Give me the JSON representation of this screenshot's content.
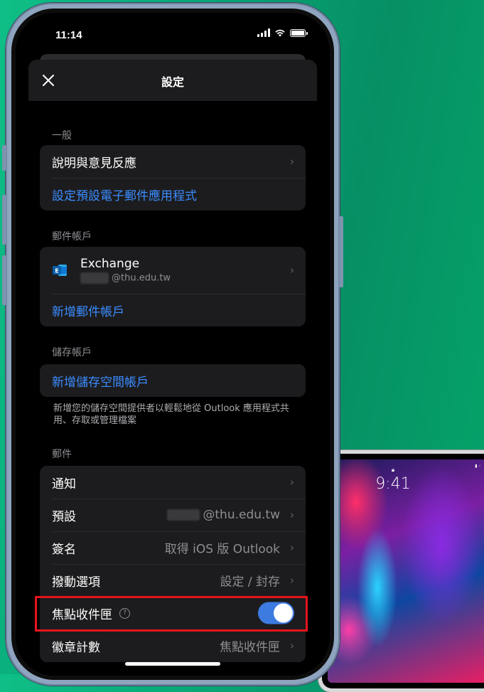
{
  "status": {
    "time": "11:14"
  },
  "header": {
    "title": "設定"
  },
  "general": {
    "label": "一般",
    "help": "說明與意見反應",
    "default_app": "設定預設電子郵件應用程式"
  },
  "mail_accounts": {
    "label": "郵件帳戶",
    "account_name": "Exchange",
    "account_email": "@thu.edu.tw",
    "add": "新增郵件帳戶"
  },
  "storage": {
    "label": "儲存帳戶",
    "add": "新增儲存空間帳戶",
    "description": "新增您的儲存空間提供者以輕鬆地從 Outlook 應用程式共用、存取或管理檔案"
  },
  "mail": {
    "label": "郵件",
    "notifications": "通知",
    "default_label": "預設",
    "default_value": "@thu.edu.tw",
    "signature_label": "簽名",
    "signature_value": "取得 iOS 版 Outlook",
    "swipe_label": "撥動選項",
    "swipe_value": "設定 / 封存",
    "focused_label": "焦點收件匣",
    "focused_on": true,
    "badge_label": "徽章計數",
    "badge_value": "焦點收件匣"
  },
  "ipad": {
    "time": "9:41"
  },
  "colors": {
    "accent": "#3b8cff",
    "toggle": "#3d7be0",
    "highlight": "#e6141b"
  }
}
